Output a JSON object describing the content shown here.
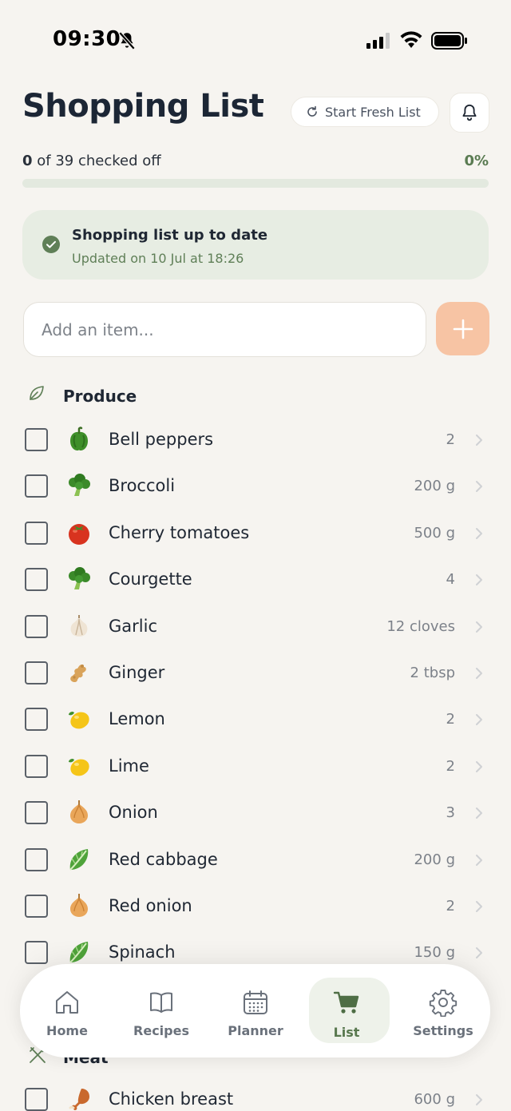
{
  "status_bar": {
    "time": "09:30"
  },
  "header": {
    "title": "Shopping List",
    "fresh_label": "Start Fresh List"
  },
  "progress": {
    "checked": "0",
    "rest": " of 39 checked off",
    "percent_label": "0%",
    "fraction": 0
  },
  "status_card": {
    "title": "Shopping list up to date",
    "subtitle": "Updated on 10 Jul at 18:26"
  },
  "add_item": {
    "placeholder": "Add an item..."
  },
  "sections": [
    {
      "title": "Produce",
      "items": [
        {
          "name": "Bell peppers",
          "qty": "2",
          "icon": "bell-pepper-icon"
        },
        {
          "name": "Broccoli",
          "qty": "200 g",
          "icon": "broccoli-icon"
        },
        {
          "name": "Cherry tomatoes",
          "qty": "500 g",
          "icon": "tomato-icon"
        },
        {
          "name": "Courgette",
          "qty": "4",
          "icon": "broccoli-icon"
        },
        {
          "name": "Garlic",
          "qty": "12 cloves",
          "icon": "garlic-icon"
        },
        {
          "name": "Ginger",
          "qty": "2 tbsp",
          "icon": "ginger-icon"
        },
        {
          "name": "Lemon",
          "qty": "2",
          "icon": "lemon-icon"
        },
        {
          "name": "Lime",
          "qty": "2",
          "icon": "lemon-icon"
        },
        {
          "name": "Onion",
          "qty": "3",
          "icon": "onion-icon"
        },
        {
          "name": "Red cabbage",
          "qty": "200 g",
          "icon": "leafy-green-icon"
        },
        {
          "name": "Red onion",
          "qty": "2",
          "icon": "onion-icon"
        },
        {
          "name": "Spinach",
          "qty": "150 g",
          "icon": "leafy-green-icon"
        }
      ]
    },
    {
      "title": "Meat",
      "items": [
        {
          "name": "Chicken breast",
          "qty": "600 g",
          "icon": "poultry-leg-icon"
        }
      ]
    }
  ],
  "nav": {
    "home": "Home",
    "recipes": "Recipes",
    "planner": "Planner",
    "list": "List",
    "settings": "Settings"
  },
  "colors": {
    "accent_green": "#5f7f57",
    "add_button": "#f7c4a4",
    "background": "#f6f4f0"
  }
}
